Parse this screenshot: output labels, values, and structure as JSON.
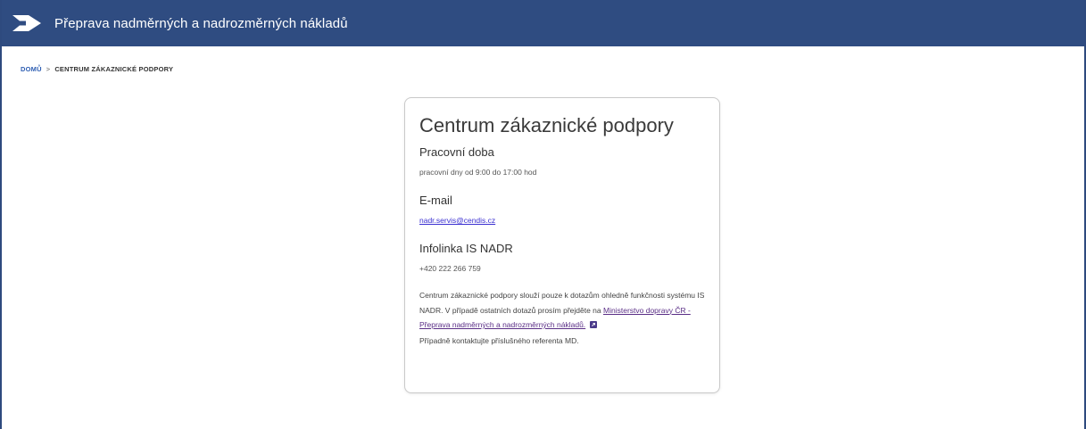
{
  "header": {
    "app_title": "Přeprava nadměrných a nadrozměrných nákladů",
    "logo_icon": "arrow-logo-icon",
    "background_color": "#2f4c81"
  },
  "breadcrumb": {
    "home": "DOMŮ",
    "separator": ">",
    "current": "CENTRUM ZÁKAZNICKÉ PODPORY"
  },
  "card": {
    "title": "Centrum zákaznické podpory",
    "working_hours": {
      "heading": "Pracovní doba",
      "value": "pracovní dny od 9:00 do 17:00 hod"
    },
    "email": {
      "heading": "E-mail",
      "value": "nadr.servis@cendis.cz"
    },
    "infoline": {
      "heading": "Infolinka IS NADR",
      "value": "+420 222 266 759"
    },
    "note": {
      "text": "Centrum zákaznické podpory slouží pouze k dotazům ohledně funkčnosti systému IS NADR. V případě ostatních dotazů prosím přejděte na",
      "link_text": "Ministerstvo dopravy ČR - Přeprava nadměrných a nadrozměrných nákladů.",
      "link_icon": "external-link-icon",
      "contact_text": "Případně kontaktujte příslušného referenta MD."
    }
  }
}
